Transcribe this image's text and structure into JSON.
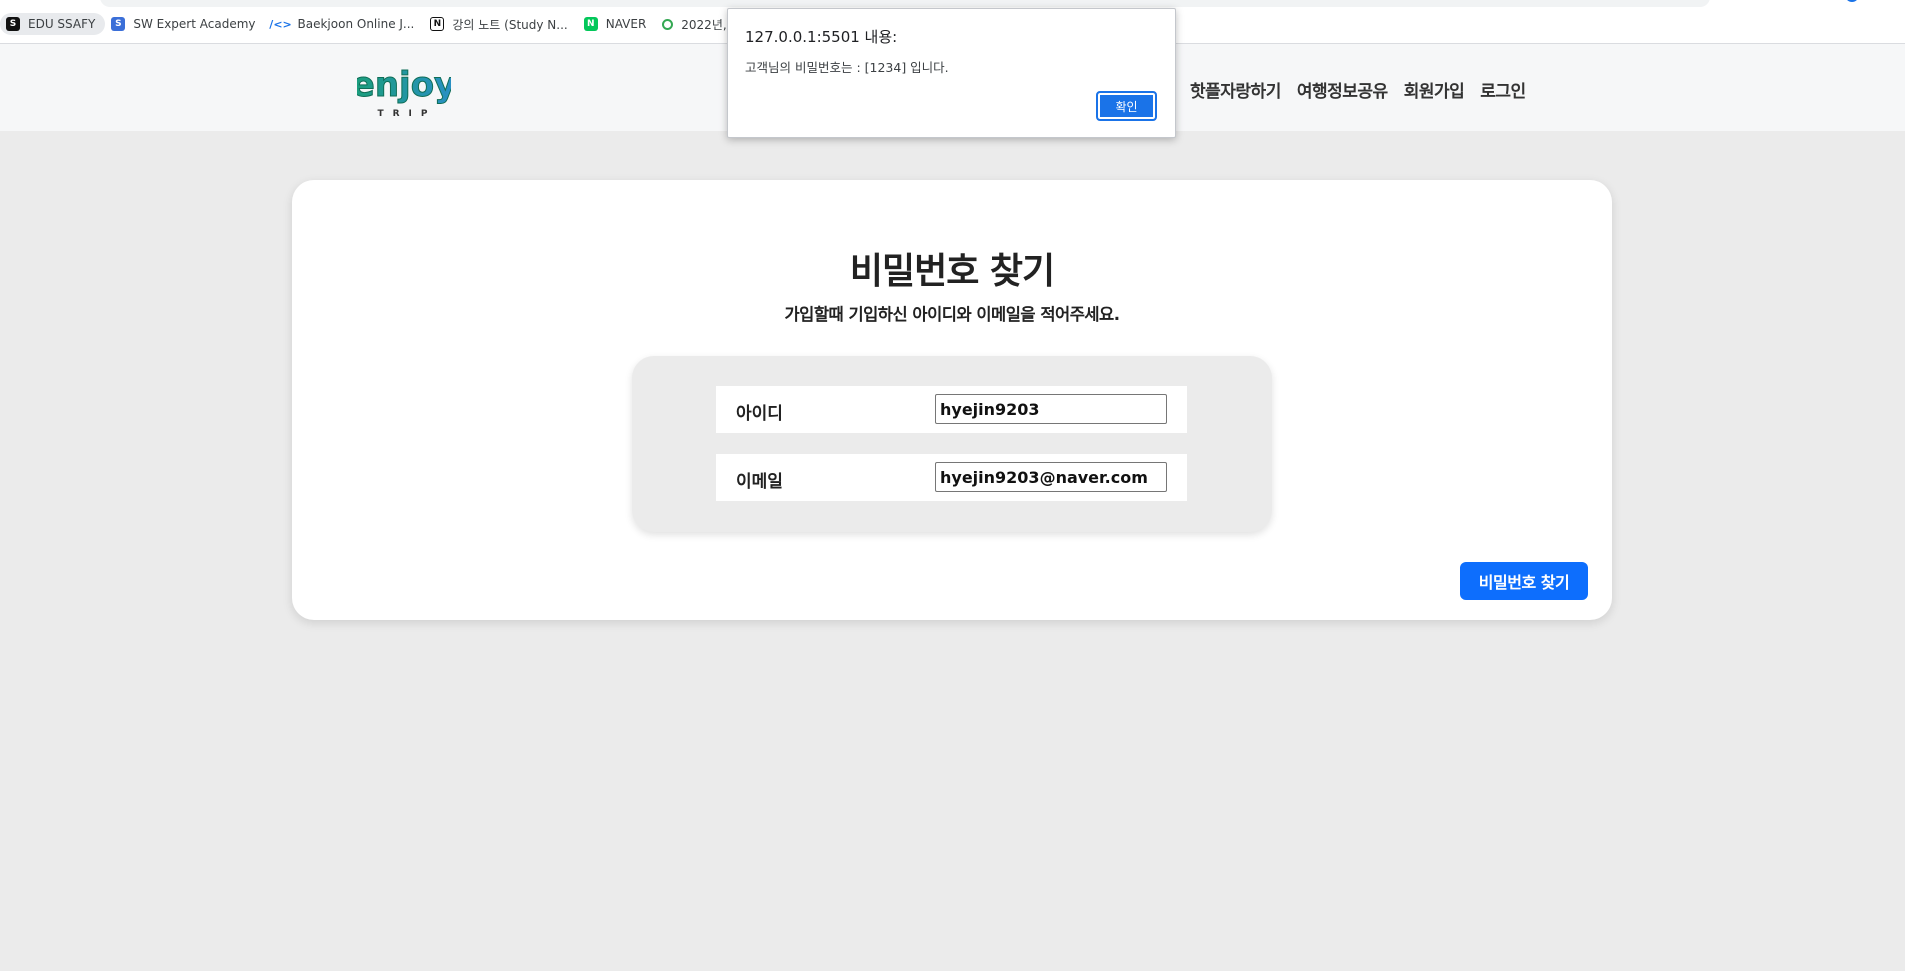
{
  "browser": {
    "bookmarks": [
      {
        "label": "EDU SSAFY",
        "icon": "ssafy-icon"
      },
      {
        "label": "SW Expert Academy",
        "icon": "swea-icon"
      },
      {
        "label": "Baekjoon Online J...",
        "icon": "baekjoon-icon"
      },
      {
        "label": "강의 노트 (Study N...",
        "icon": "notion-icon"
      },
      {
        "label": "NAVER",
        "icon": "naver-icon"
      },
      {
        "label": "2022년, 인프",
        "icon": "inflearn-icon"
      }
    ]
  },
  "header": {
    "logo_text": "enjoy",
    "logo_sub": "TRIP",
    "nav": [
      "핫플자랑하기",
      "여행정보공유",
      "회원가입",
      "로그인"
    ]
  },
  "alert": {
    "title": "127.0.0.1:5501 내용:",
    "message": "고객님의 비밀번호는 : [1234] 입니다.",
    "ok_label": "확인"
  },
  "main": {
    "title": "비밀번호 찾기",
    "subtitle": "가입할때 기입하신 아이디와 이메일을 적어주세요.",
    "fields": [
      {
        "label": "아이디",
        "value": "hyejin9203"
      },
      {
        "label": "이메일",
        "value": "hyejin9203@naver.com"
      }
    ],
    "submit_label": "비밀번호 찾기"
  },
  "colors": {
    "primary": "#0d6efd",
    "logo_green": "#1a9e7a",
    "logo_blue": "#2a8fc7",
    "page_bg": "#ebebeb"
  }
}
